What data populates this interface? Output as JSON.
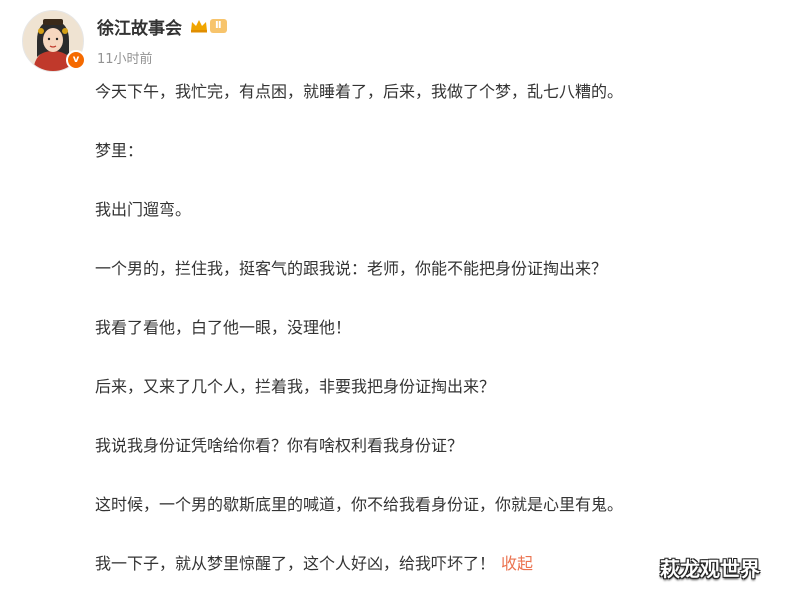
{
  "author": {
    "name": "徐江故事会",
    "level": "Ⅱ",
    "verified_mark": "v",
    "time": "11小时前",
    "icons": {
      "crown": "crown-icon",
      "verified": "verified-badge-icon",
      "avatar": "avatar-illustration"
    }
  },
  "post": {
    "paragraphs": [
      "今天下午，我忙完，有点困，就睡着了，后来，我做了个梦，乱七八糟的。",
      "梦里：",
      "我出门遛弯。",
      "一个男的，拦住我，挺客气的跟我说：老师，你能不能把身份证掏出来？",
      "我看了看他，白了他一眼，没理他！",
      "后来，又来了几个人，拦着我，非要我把身份证掏出来？",
      "我说我身份证凭啥给你看？你有啥权利看我身份证？",
      "这时候，一个男的歇斯底里的喊道，你不给我看身份证，你就是心里有鬼。",
      "我一下子，就从梦里惊醒了，这个人好凶，给我吓坏了！"
    ],
    "collapse_label": "收起"
  },
  "watermark": "萩龙观世界",
  "colors": {
    "text": "#333333",
    "time": "#939393",
    "link": "#eb7350",
    "verified": "#f56a00",
    "level_badge": "#f7c46c"
  }
}
